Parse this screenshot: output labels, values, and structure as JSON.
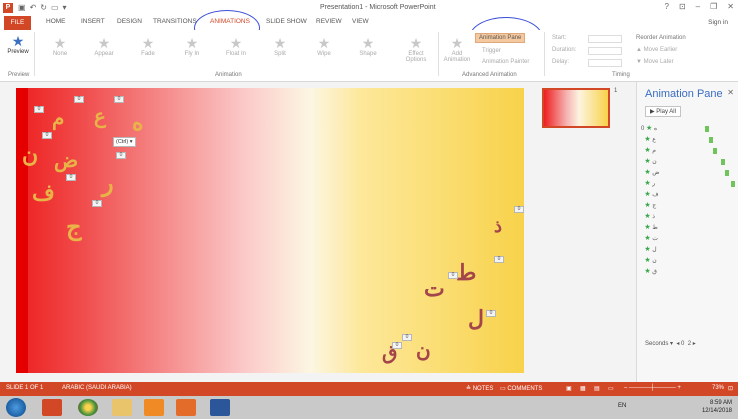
{
  "window": {
    "title": "Presentation1 - Microsoft PowerPoint",
    "app_icon": "P",
    "controls": [
      "?",
      "⊡",
      "–",
      "❐",
      "✕"
    ]
  },
  "ribbon_tabs": {
    "file": "FILE",
    "items": [
      "HOME",
      "INSERT",
      "DESIGN",
      "TRANSITIONS",
      "ANIMATIONS",
      "SLIDE SHOW",
      "REVIEW",
      "VIEW"
    ],
    "active": "ANIMATIONS",
    "sign_in": "Sign in"
  },
  "ribbon": {
    "preview": "Preview",
    "preview_group": "Preview",
    "effects": [
      "None",
      "Appear",
      "Fade",
      "Fly In",
      "Float In",
      "Split",
      "Wipe",
      "Shape"
    ],
    "effect_options": "Effect Options",
    "animation_group": "Animation",
    "add_animation": "Add Animation",
    "animation_pane": "Animation Pane",
    "trigger": "Trigger",
    "animation_painter": "Animation Painter",
    "advanced_group": "Advanced Animation",
    "start": "Start:",
    "duration": "Duration:",
    "delay": "Delay:",
    "timing_group": "Timing",
    "reorder": "Reorder Animation",
    "move_earlier": "▲ Move Earlier",
    "move_later": "▼ Move Later"
  },
  "slide": {
    "letters": [
      {
        "ch": "ه",
        "tag": "0"
      },
      {
        "ch": "ع",
        "tag": "0"
      },
      {
        "ch": "م",
        "tag": "0"
      },
      {
        "ch": "ن",
        "tag": "0"
      },
      {
        "ch": "ض",
        "tag": "0"
      },
      {
        "ch": "ر",
        "tag": "0"
      },
      {
        "ch": "ف",
        "tag": "0"
      },
      {
        "ch": "ج",
        "tag": "0"
      },
      {
        "ch": "ذ",
        "tag": "0"
      },
      {
        "ch": "ط",
        "tag": "0"
      },
      {
        "ch": "ت",
        "tag": "0"
      },
      {
        "ch": "ل",
        "tag": "0"
      },
      {
        "ch": "ن",
        "tag": "0"
      },
      {
        "ch": "ق",
        "tag": "0"
      }
    ],
    "ctrl_tag": "(Ctrl) ▾"
  },
  "thumbnail": {
    "number": "1"
  },
  "animation_pane": {
    "title": "Animation Pane",
    "play_all": "▶ Play All",
    "first_index": "0",
    "items": [
      "ه",
      "ع",
      "م",
      "ن",
      "ض",
      "ر",
      "ف",
      "ج",
      "ذ",
      "ط",
      "ت",
      "ل",
      "ن",
      "ق"
    ],
    "seconds_label": "Seconds ▾",
    "seconds_from": "0",
    "seconds_to": "2"
  },
  "statusbar": {
    "slide_info": "SLIDE 1 OF 1",
    "language": "ARABIC (SAUDI ARABIA)",
    "notes": "≙ NOTES",
    "comments": "▭ COMMENTS",
    "zoom": "73%"
  },
  "taskbar": {
    "lang": "EN",
    "time": "8:59 AM",
    "date": "12/14/2018"
  },
  "colors": {
    "accent": "#d24726",
    "highlight_ellipse": "#3b4fd8",
    "letter_gold": "#e8b347",
    "letter_dark": "#a3454a"
  }
}
